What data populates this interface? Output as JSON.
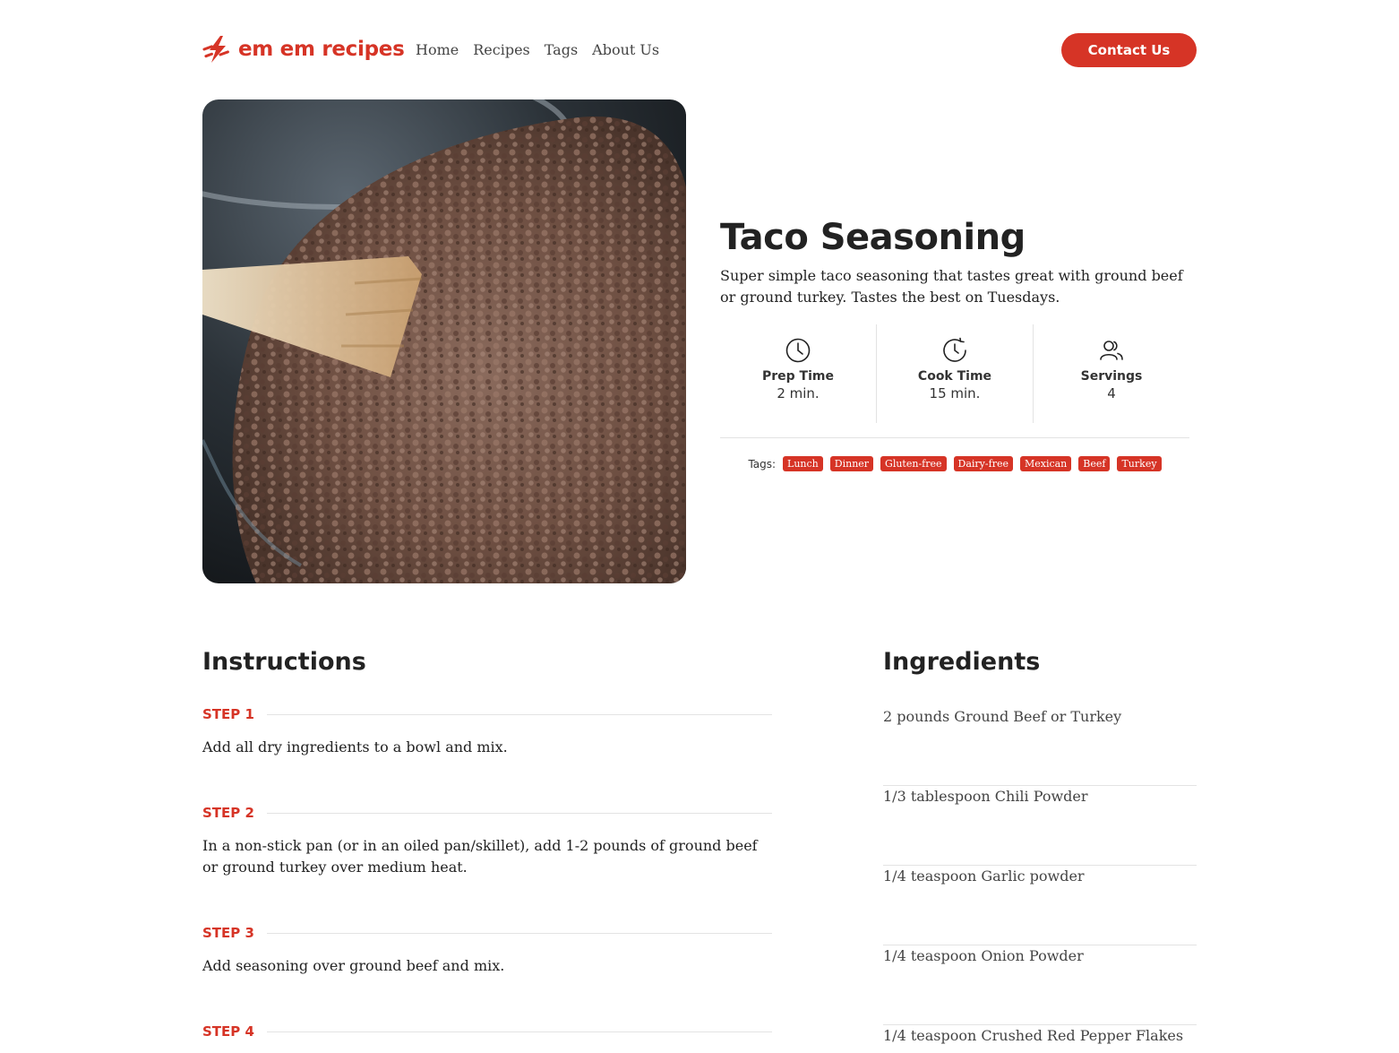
{
  "brand": {
    "name": "em em recipes",
    "accent": "#d63426"
  },
  "nav": {
    "items": [
      "Home",
      "Recipes",
      "Tags",
      "About Us"
    ],
    "contact_label": "Contact Us"
  },
  "recipe": {
    "title": "Taco Seasoning",
    "description": "Super simple taco seasoning that tastes great with ground beef or ground turkey. Tastes the best on Tuesdays.",
    "image_icon": "ground-beef-photo",
    "stats": [
      {
        "icon": "clock-icon",
        "label": "Prep Time",
        "value": "2 min."
      },
      {
        "icon": "clock-refresh-icon",
        "label": "Cook Time",
        "value": "15 min."
      },
      {
        "icon": "users-icon",
        "label": "Servings",
        "value": "4"
      }
    ],
    "tags_label": "Tags:",
    "tags": [
      "Lunch",
      "Dinner",
      "Gluten-free",
      "Dairy-free",
      "Mexican",
      "Beef",
      "Turkey"
    ]
  },
  "instructions": {
    "title": "Instructions",
    "steps": [
      {
        "label": "STEP 1",
        "text": "Add all dry ingredients to a bowl and mix."
      },
      {
        "label": "STEP 2",
        "text": "In a non-stick pan (or in an oiled pan/skillet), add 1-2 pounds of ground beef or ground turkey over medium heat."
      },
      {
        "label": "STEP 3",
        "text": "Add seasoning over ground beef and mix."
      },
      {
        "label": "STEP 4",
        "text": ""
      }
    ]
  },
  "ingredients": {
    "title": "Ingredients",
    "items": [
      "2 pounds Ground Beef or Turkey",
      "1/3 tablespoon Chili Powder",
      "1/4 teaspoon Garlic powder",
      "1/4 teaspoon Onion Powder",
      "1/4 teaspoon Crushed Red Pepper Flakes"
    ]
  }
}
